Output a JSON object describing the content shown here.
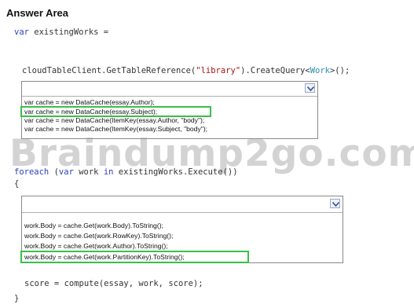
{
  "title": "Answer Area",
  "code": {
    "line1_kw": "var",
    "line1_rest": " existingWorks =",
    "line2_a": "cloudTableClient.GetTableReference(",
    "line2_str": "\"library\"",
    "line2_b": ").CreateQuery<",
    "line2_type": "Work",
    "line2_c": ">();",
    "line3_kw1": "foreach",
    "line3_b": " (",
    "line3_kw2": "var",
    "line3_c": " work ",
    "line3_kw3": "in",
    "line3_d": " existingWorks.Execute())",
    "brace_open": "{",
    "score_line": "score = compute(essay, work, score);",
    "brace_close": "}"
  },
  "dropdown1": {
    "selected": "",
    "options": [
      "var cache = new DataCache(essay.Author);",
      "var cache = new DataCache(essay.Subject);",
      "var cache = new DataCache(ItemKey(essay.Author, \"body\");",
      "var cache = new DataCache(ItemKey(essay.Subject, \"body\");"
    ]
  },
  "dropdown2": {
    "selected": "",
    "options": [
      "work.Body = cache.Get(work.Body).ToString();",
      "work.Body = cache.Get(work.RowKey).ToString();",
      "work.Body = cache.Get(work.Author).ToString();",
      "work.Body = cache.Get(work.PartitionKey).ToString();"
    ]
  },
  "watermark": "Braindump2go.com",
  "colors": {
    "highlight": "#36c24a",
    "keyword": "#2a3fbf",
    "string": "#a31515",
    "type": "#2b91af"
  }
}
